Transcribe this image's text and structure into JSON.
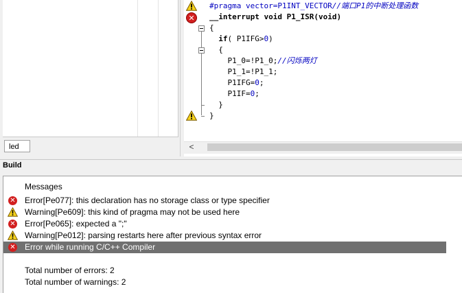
{
  "workspace": {
    "tab_label": "led"
  },
  "editor": {
    "lines": [
      {
        "parts": [
          {
            "t": "#pragma vector=P1INT_VECTOR",
            "c": "pp"
          },
          {
            "t": "//端口P1的中断处理函数",
            "c": "cm"
          }
        ]
      },
      {
        "parts": [
          {
            "t": "__interrupt ",
            "c": "kw"
          },
          {
            "t": "void ",
            "c": "kw"
          },
          {
            "t": "P1_ISR(",
            "c": "kw"
          },
          {
            "t": "void",
            "c": "kw"
          },
          {
            "t": ")",
            "c": "kw"
          }
        ]
      },
      {
        "parts": [
          {
            "t": "{",
            "c": ""
          }
        ]
      },
      {
        "parts": [
          {
            "t": "  ",
            "c": ""
          },
          {
            "t": "if",
            "c": "kw"
          },
          {
            "t": "( P1IFG>",
            "c": ""
          },
          {
            "t": "0",
            "c": "num"
          },
          {
            "t": ")",
            "c": ""
          }
        ]
      },
      {
        "parts": [
          {
            "t": "  {",
            "c": ""
          }
        ]
      },
      {
        "parts": [
          {
            "t": "    P1_0=!P1_0;",
            "c": ""
          },
          {
            "t": "//闪烁两灯",
            "c": "cm"
          }
        ]
      },
      {
        "parts": [
          {
            "t": "    P1_1=!P1_1;",
            "c": ""
          }
        ]
      },
      {
        "parts": [
          {
            "t": "    P1IFG=",
            "c": ""
          },
          {
            "t": "0",
            "c": "num"
          },
          {
            "t": ";",
            "c": ""
          }
        ]
      },
      {
        "parts": [
          {
            "t": "    P1IF=",
            "c": ""
          },
          {
            "t": "0",
            "c": "num"
          },
          {
            "t": ";",
            "c": ""
          }
        ]
      },
      {
        "parts": [
          {
            "t": "  }",
            "c": ""
          }
        ]
      },
      {
        "parts": [
          {
            "t": "}",
            "c": ""
          }
        ]
      }
    ],
    "gutter_markers": [
      {
        "line": 0,
        "icon": "warning-icon"
      },
      {
        "line": 1,
        "icon": "error-icon"
      },
      {
        "line": 10,
        "icon": "warning-icon"
      }
    ],
    "hscroll_left_arrow": "<"
  },
  "build": {
    "title": "Build",
    "header": "Messages",
    "messages": [
      {
        "icon": "error-icon",
        "text": "Error[Pe077]: this declaration has no storage class or type specifier"
      },
      {
        "icon": "warning-icon",
        "text": "Warning[Pe609]: this kind of pragma may not be used here"
      },
      {
        "icon": "error-icon",
        "text": "Error[Pe065]: expected a \";\""
      },
      {
        "icon": "warning-icon",
        "text": "Warning[Pe012]: parsing restarts here after previous syntax error"
      },
      {
        "icon": "error-icon",
        "text": "Error while running C/C++ Compiler",
        "selected": true
      }
    ],
    "total_errors": "Total number of errors: 2",
    "total_warnings": "Total number of warnings: 2"
  },
  "colors": {
    "error": "#d21f1f",
    "warning": "#f5d21c",
    "selection": "#707070",
    "preprocessor": "#0000c0"
  }
}
